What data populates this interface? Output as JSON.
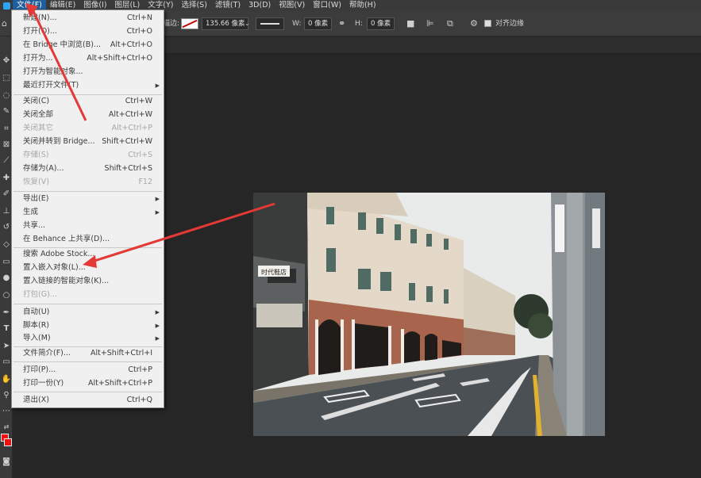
{
  "menubar": {
    "items": [
      {
        "label": "文件(F)",
        "active": true
      },
      {
        "label": "编辑(E)"
      },
      {
        "label": "图像(I)"
      },
      {
        "label": "图层(L)"
      },
      {
        "label": "文字(Y)"
      },
      {
        "label": "选择(S)"
      },
      {
        "label": "滤镜(T)"
      },
      {
        "label": "3D(D)"
      },
      {
        "label": "视图(V)"
      },
      {
        "label": "窗口(W)"
      },
      {
        "label": "帮助(H)"
      }
    ]
  },
  "options": {
    "stroke_label": "描边:",
    "stroke_width": "135.66 像素",
    "w_label": "W:",
    "w_value": "0 像素",
    "h_label": "H:",
    "h_value": "0 像素",
    "align_edges": "对齐边缘"
  },
  "file_menu": {
    "items": [
      {
        "label": "新建(N)...",
        "shortcut": "Ctrl+N"
      },
      {
        "label": "打开(O)...",
        "shortcut": "Ctrl+O"
      },
      {
        "label": "在 Bridge 中浏览(B)...",
        "shortcut": "Alt+Ctrl+O"
      },
      {
        "label": "打开为...",
        "shortcut": "Alt+Shift+Ctrl+O"
      },
      {
        "label": "打开为智能对象...",
        "shortcut": ""
      },
      {
        "label": "最近打开文件(T)",
        "shortcut": "",
        "submenu": true
      },
      {
        "label": "关闭(C)",
        "shortcut": "Ctrl+W"
      },
      {
        "label": "关闭全部",
        "shortcut": "Alt+Ctrl+W"
      },
      {
        "label": "关闭其它",
        "shortcut": "Alt+Ctrl+P",
        "disabled": true
      },
      {
        "label": "关闭并转到 Bridge...",
        "shortcut": "Shift+Ctrl+W"
      },
      {
        "label": "存储(S)",
        "shortcut": "Ctrl+S",
        "disabled": true
      },
      {
        "label": "存储为(A)...",
        "shortcut": "Shift+Ctrl+S"
      },
      {
        "label": "恢复(V)",
        "shortcut": "F12",
        "disabled": true
      },
      {
        "label": "导出(E)",
        "shortcut": "",
        "submenu": true
      },
      {
        "label": "生成",
        "shortcut": "",
        "submenu": true
      },
      {
        "label": "共享...",
        "shortcut": ""
      },
      {
        "label": "在 Behance 上共享(D)...",
        "shortcut": ""
      },
      {
        "label": "搜索 Adobe Stock...",
        "shortcut": ""
      },
      {
        "label": "置入嵌入对象(L)...",
        "shortcut": ""
      },
      {
        "label": "置入链接的智能对象(K)...",
        "shortcut": ""
      },
      {
        "label": "打包(G)...",
        "shortcut": "",
        "disabled": true
      },
      {
        "label": "自动(U)",
        "shortcut": "",
        "submenu": true
      },
      {
        "label": "脚本(R)",
        "shortcut": "",
        "submenu": true
      },
      {
        "label": "导入(M)",
        "shortcut": "",
        "submenu": true
      },
      {
        "label": "文件简介(F)...",
        "shortcut": "Alt+Shift+Ctrl+I"
      },
      {
        "label": "打印(P)...",
        "shortcut": "Ctrl+P"
      },
      {
        "label": "打印一份(Y)",
        "shortcut": "Alt+Shift+Ctrl+P"
      },
      {
        "label": "退出(X)",
        "shortcut": "Ctrl+Q"
      }
    ]
  },
  "photo": {
    "shop_sign": "时代鞋店"
  },
  "colors": {
    "accent": "#1f5f9e",
    "annotation_arrow": "#e53935",
    "foreground": "#e11111"
  }
}
